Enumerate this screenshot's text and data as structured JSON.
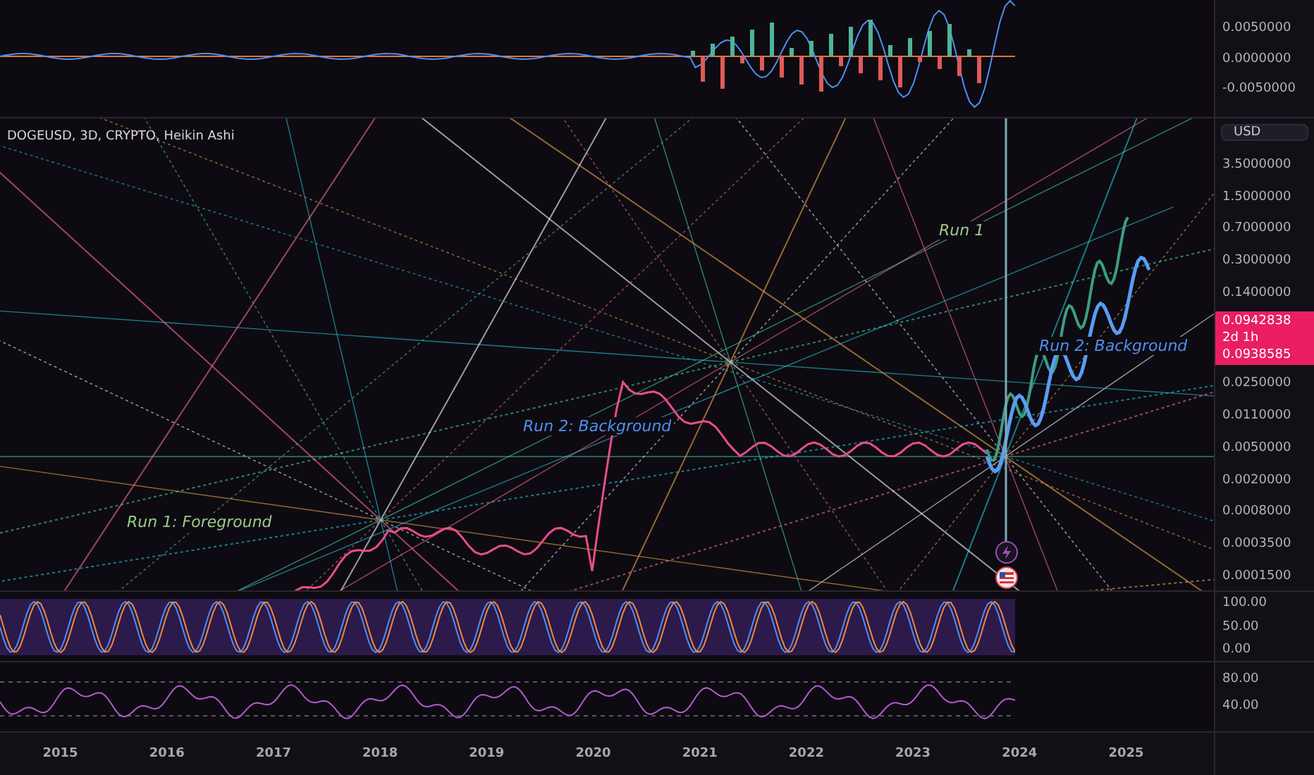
{
  "macd_panel": {
    "axis_labels": [
      "0.0050000",
      "0.0000000",
      "-0.0050000"
    ]
  },
  "main_panel": {
    "legend": "DOGEUSD, 3D, CRYPTO, Heikin Ashi",
    "currency_button": "USD",
    "annotations": [
      {
        "text": "Run 1: Foreground",
        "color": "#9cc98a"
      },
      {
        "text": "Run 2: Background",
        "color": "#4d8ff2"
      },
      {
        "text": "Run 1",
        "color": "#9cc98a"
      },
      {
        "text": "Run 2: Background",
        "color": "#4d8ff2"
      }
    ],
    "axis_labels": [
      "3.5000000",
      "1.5000000",
      "0.7000000",
      "0.3000000",
      "0.1400000",
      "0.0250000",
      "0.0110000",
      "0.0050000",
      "0.0020000",
      "0.0008000",
      "0.0003500",
      "0.0001500"
    ],
    "price_tag": {
      "price": "0.0942838",
      "countdown": "2d 1h",
      "previous": "0.0938585"
    }
  },
  "stoch_panel": {
    "axis_labels": [
      "100.00",
      "50.00",
      "0.00"
    ]
  },
  "rsi_panel": {
    "axis_labels": [
      "80.00",
      "40.00"
    ]
  },
  "time_axis": [
    "2015",
    "2016",
    "2017",
    "2018",
    "2019",
    "2020",
    "2021",
    "2022",
    "2023",
    "2024",
    "2025"
  ]
}
